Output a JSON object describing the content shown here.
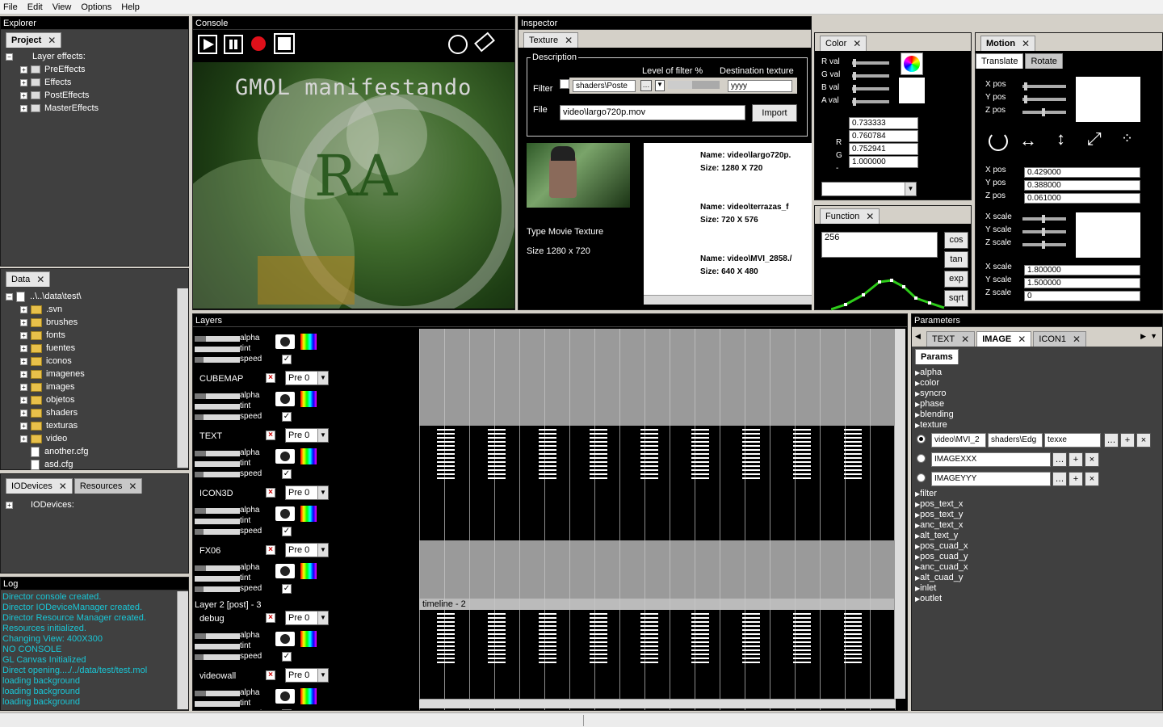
{
  "menu": [
    "File",
    "Edit",
    "View",
    "Options",
    "Help"
  ],
  "explorer": {
    "title": "Explorer",
    "tab": "Project",
    "items": [
      "Layer effects:",
      "PreEffects",
      "Effects",
      "PostEffects",
      "MasterEffects"
    ]
  },
  "data": {
    "tab": "Data",
    "root": "..\\..\\data\\test\\",
    "folders": [
      ".svn",
      "brushes",
      "fonts",
      "fuentes",
      "iconos",
      "imagenes",
      "images",
      "objetos",
      "shaders",
      "texturas",
      "video"
    ],
    "files": [
      "another.cfg",
      "asd.cfg"
    ]
  },
  "io": {
    "tab1": "IODevices",
    "tab2": "Resources",
    "item": "IODevices:"
  },
  "log": {
    "title": "Log",
    "lines": [
      "Director console created.",
      "Director IODeviceManager created.",
      "Director Resource Manager created.",
      "Resources initialized.",
      "Changing View: 400X300",
      "NO CONSOLE",
      "GL Canvas Initialized",
      "Direct opening..../../data/test/test.mol",
      "loading background",
      "loading background",
      "loading background"
    ]
  },
  "console": {
    "title": "Console",
    "overlay": "GMOL manifestando"
  },
  "inspector": {
    "title": "Inspector",
    "tab": "Texture",
    "desc": "Description",
    "lof": "Level of filter %",
    "dest": "Destination texture",
    "filter": "Filter",
    "shader": "shaders\\Poste",
    "destval": "yyyy",
    "file": "File",
    "fileval": "video\\largo720p.mov",
    "import": "Import",
    "type": "Type Movie Texture",
    "size": "Size 1280 x 720",
    "list": [
      {
        "n": "Name: video\\largo720p.",
        "s": "Size: 1280 X 720"
      },
      {
        "n": "Name: video\\terrazas_f",
        "s": "Size: 720 X 576"
      },
      {
        "n": "Name: video\\MVI_2858./",
        "s": "Size: 640 X 480"
      }
    ]
  },
  "color": {
    "tab": "Color",
    "labels": [
      "R val",
      "G val",
      "B val",
      "A val"
    ],
    "vals": [
      "0.733333",
      "0.760784",
      "0.752941",
      "1.000000"
    ],
    "side": [
      "R",
      "G",
      "-"
    ]
  },
  "function": {
    "tab": "Function",
    "val": "256",
    "btns": [
      "cos",
      "tan",
      "exp",
      "sqrt"
    ]
  },
  "motion": {
    "tab": "Motion",
    "sub1": "Translate",
    "sub2": "Rotate",
    "pos": [
      "X pos",
      "Y pos",
      "Z pos"
    ],
    "posvals": [
      "0.429000",
      "0.388000",
      "0.061000"
    ],
    "scale": [
      "X scale",
      "Y scale",
      "Z scale"
    ],
    "scalevals": [
      "1.800000",
      "1.500000",
      "0"
    ]
  },
  "layers": {
    "title": "Layers",
    "props": [
      "alpha",
      "tint",
      "speed"
    ],
    "named": [
      "CUBEMAP",
      "TEXT",
      "ICON3D",
      "FX06",
      "debug",
      "videowall"
    ],
    "pre": "Pre 0",
    "group": "Layer 2 [post] - 3",
    "timeline": "timeline - 2"
  },
  "params": {
    "title": "Parameters",
    "tabs": [
      "TEXT",
      "IMAGE",
      "ICON1"
    ],
    "sub": "Params",
    "top": [
      "alpha",
      "color",
      "syncro",
      "phase",
      "blending",
      "texture"
    ],
    "tex": [
      {
        "a": "video\\MVI_2",
        "b": "shaders\\Edg",
        "c": "texxe"
      },
      {
        "a": "IMAGEXXX"
      },
      {
        "a": "IMAGEYYY"
      }
    ],
    "bottom": [
      "filter",
      "pos_text_x",
      "pos_text_y",
      "anc_text_x",
      "alt_text_y",
      "pos_cuad_x",
      "pos_cuad_y",
      "anc_cuad_x",
      "alt_cuad_y",
      "inlet",
      "outlet"
    ]
  }
}
